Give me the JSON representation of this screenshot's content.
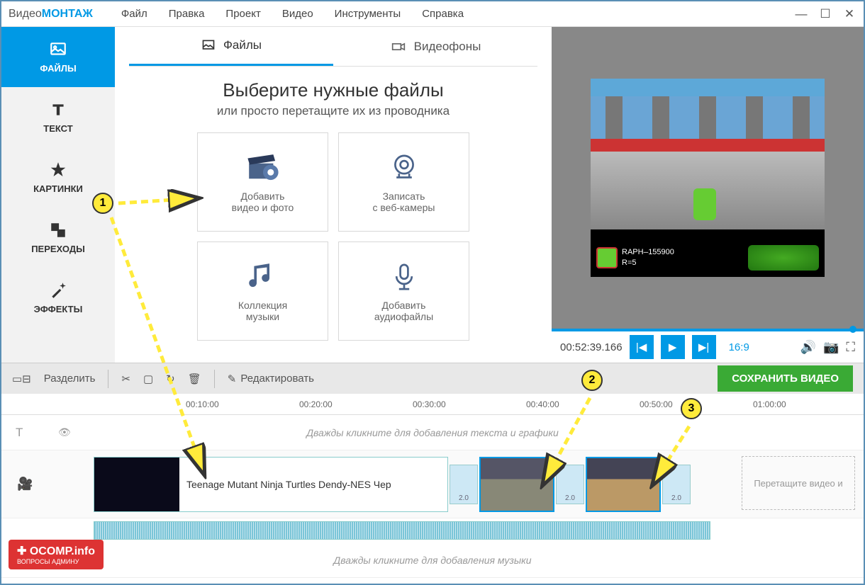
{
  "app": {
    "name1": "Видео",
    "name2": "МОНТАЖ"
  },
  "menu": {
    "file": "Файл",
    "edit": "Правка",
    "project": "Проект",
    "video": "Видео",
    "tools": "Инструменты",
    "help": "Справка"
  },
  "sidebar": {
    "files": "ФАЙЛЫ",
    "text": "ТЕКСТ",
    "pictures": "КАРТИНКИ",
    "transitions": "ПЕРЕХОДЫ",
    "effects": "ЭФФЕКТЫ"
  },
  "tabs": {
    "files": "Файлы",
    "videobg": "Видеофоны"
  },
  "headline": {
    "title": "Выберите нужные файлы",
    "sub": "или просто перетащите их из проводника"
  },
  "cards": {
    "add_video_l1": "Добавить",
    "add_video_l2": "видео и фото",
    "webcam_l1": "Записать",
    "webcam_l2": "с веб-камеры",
    "music_l1": "Коллекция",
    "music_l2": "музыки",
    "audio_l1": "Добавить",
    "audio_l2": "аудиофайлы"
  },
  "preview": {
    "hud_name": "RAPH",
    "hud_score": "155900",
    "hud_r": "R=5",
    "time": "00:52:39.166",
    "ratio": "16:9"
  },
  "toolbar": {
    "split": "Разделить",
    "edit": "Редактировать",
    "save": "СОХРАНИТЬ ВИДЕО"
  },
  "ruler": {
    "t1": "00:10:00",
    "t2": "00:20:00",
    "t3": "00:30:00",
    "t4": "00:40:00",
    "t5": "00:50:00",
    "t6": "01:00:00"
  },
  "tracks": {
    "text_hint": "Дважды кликните для добавления текста и графики",
    "music_hint": "Дважды кликните для добавления музыки",
    "clip_name": "Teenage Mutant Ninja Turtles Dendy-NES  Чер",
    "dropzone": "Перетащите видео и",
    "trans_dur": "2.0"
  },
  "callouts": {
    "c1": "1",
    "c2": "2",
    "c3": "3"
  },
  "watermark": {
    "site": "OCOMP.info",
    "tag": "ВОПРОСЫ АДМИНУ"
  }
}
